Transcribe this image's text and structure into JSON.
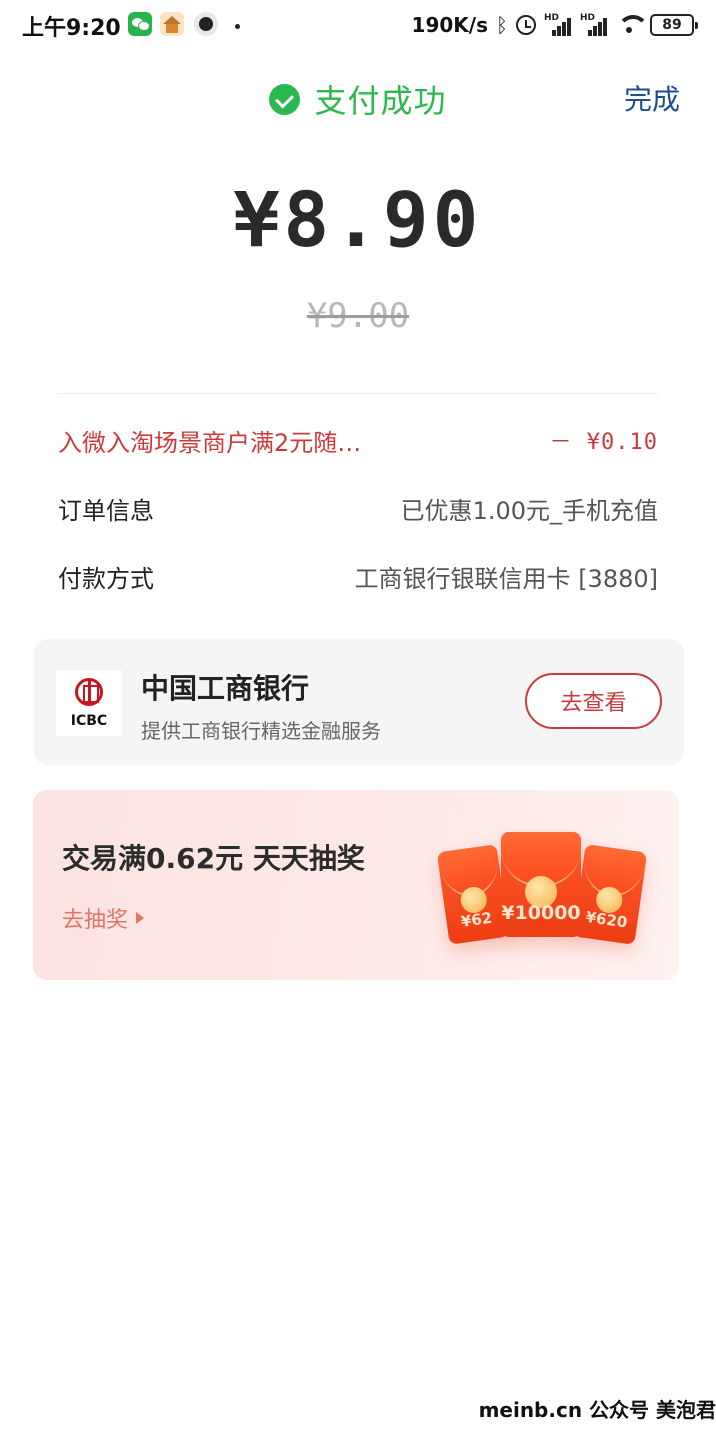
{
  "status_bar": {
    "time": "上午9:20",
    "speed": "190K/s",
    "battery": "89",
    "hd_label": "HD",
    "icons": [
      "wechat-icon",
      "house-app-icon",
      "dark-app-icon",
      "bluetooth-icon",
      "alarm-icon",
      "signal-icon",
      "signal-icon",
      "wifi-icon",
      "battery-icon"
    ]
  },
  "header": {
    "title": "支付成功",
    "done_label": "完成",
    "accent_color": "#2bb94f"
  },
  "payment": {
    "amount": "¥8.90",
    "original_amount": "¥9.00"
  },
  "details": {
    "discount_label": "入微入淘场景商户满2元随…",
    "discount_value": "－ ¥0.10",
    "order_label": "订单信息",
    "order_value": "已优惠1.00元_手机充值",
    "pay_label": "付款方式",
    "pay_value": "工商银行银联信用卡 [3880]"
  },
  "bank_card": {
    "logo_text": "ICBC",
    "name": "中国工商银行",
    "subtitle": "提供工商银行精选金融服务",
    "button_label": "去查看"
  },
  "lottery": {
    "title": "交易满0.62元  天天抽奖",
    "link_label": "去抽奖",
    "envelopes": [
      "¥62",
      "¥10000",
      "¥620"
    ]
  },
  "watermark": "meinb.cn  公众号 美泡君"
}
